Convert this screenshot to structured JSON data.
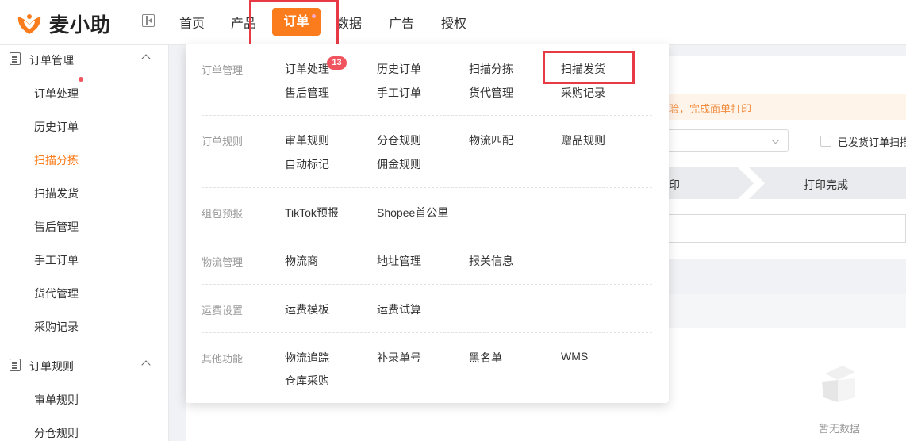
{
  "app": {
    "name": "麦小助",
    "accent_color": "#fa7c1c",
    "highlight_color": "#e83a45",
    "badge_color": "#f0545f"
  },
  "topnav": {
    "items": [
      {
        "label": "首页"
      },
      {
        "label": "产品"
      },
      {
        "label": "订单",
        "active": true
      },
      {
        "label": "数据"
      },
      {
        "label": "广告"
      },
      {
        "label": "授权"
      }
    ]
  },
  "sidebar": {
    "groups": [
      {
        "label": "订单管理",
        "icon": "clipboard-icon",
        "expanded": true,
        "items": [
          {
            "label": "订单处理",
            "has_dot": true
          },
          {
            "label": "历史订单"
          },
          {
            "label": "扫描分拣",
            "active": true
          },
          {
            "label": "扫描发货"
          },
          {
            "label": "售后管理"
          },
          {
            "label": "手工订单"
          },
          {
            "label": "货代管理"
          },
          {
            "label": "采购记录"
          }
        ]
      },
      {
        "label": "订单规则",
        "icon": "document-icon",
        "expanded": true,
        "items": [
          {
            "label": "审单规则"
          },
          {
            "label": "分仓规则"
          }
        ]
      }
    ]
  },
  "main": {
    "notice_text": "验，完成面单打印",
    "checkbox_label": "已发货订单扫描",
    "steps": [
      "印",
      "打印完成"
    ],
    "empty_text": "暂无数据"
  },
  "menu": {
    "sections": [
      {
        "category": "订单管理",
        "links": [
          "订单处理",
          "历史订单",
          "扫描分拣",
          "扫描发货",
          "售后管理",
          "手工订单",
          "货代管理",
          "采购记录"
        ],
        "badge": "13",
        "highlighted": "扫描发货"
      },
      {
        "category": "订单规则",
        "links": [
          "审单规则",
          "分仓规则",
          "物流匹配",
          "赠品规则",
          "自动标记",
          "佣金规则"
        ]
      },
      {
        "category": "组包预报",
        "links": [
          "TikTok预报",
          "Shopee首公里"
        ]
      },
      {
        "category": "物流管理",
        "links": [
          "物流商",
          "地址管理",
          "报关信息"
        ]
      },
      {
        "category": "运费设置",
        "links": [
          "运费模板",
          "运费试算"
        ]
      },
      {
        "category": "其他功能",
        "links": [
          "物流追踪",
          "补录单号",
          "黑名单",
          "WMS",
          "仓库采购"
        ]
      }
    ]
  }
}
